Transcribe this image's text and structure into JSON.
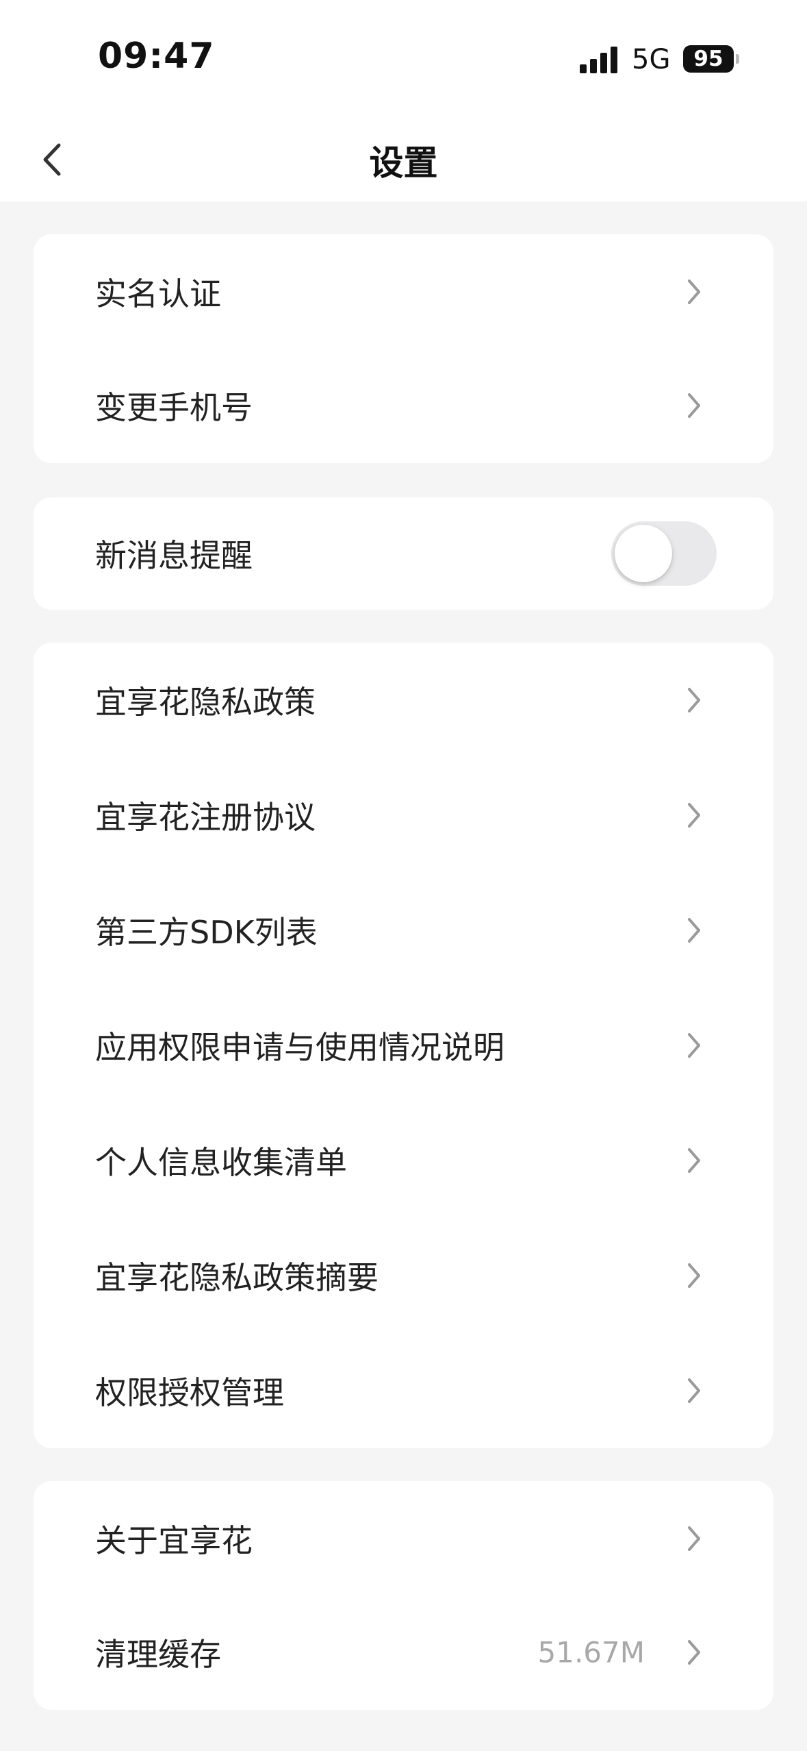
{
  "status_bar": {
    "time": "09:47",
    "network": "5G",
    "battery": "95"
  },
  "nav": {
    "title": "设置",
    "back_icon": "chevron-left-icon"
  },
  "account_group": {
    "items": [
      {
        "label": "实名认证"
      },
      {
        "label": "变更手机号"
      }
    ]
  },
  "notification_group": {
    "label": "新消息提醒",
    "toggle_on": false
  },
  "policy_group": {
    "items": [
      {
        "label": "宜享花隐私政策"
      },
      {
        "label": "宜享花注册协议"
      },
      {
        "label": "第三方SDK列表"
      },
      {
        "label": "应用权限申请与使用情况说明"
      },
      {
        "label": "个人信息收集清单"
      },
      {
        "label": "宜享花隐私政策摘要"
      },
      {
        "label": "权限授权管理"
      }
    ]
  },
  "app_group": {
    "items": [
      {
        "label": "关于宜享花"
      },
      {
        "label": "清理缓存",
        "value": "51.67M"
      }
    ]
  },
  "colors": {
    "background": "#f5f5f5",
    "card": "#ffffff",
    "text": "#222222",
    "secondary_text": "#a8a8a8",
    "chevron": "#9a9a9a",
    "toggle_off": "#e9e9eb"
  }
}
